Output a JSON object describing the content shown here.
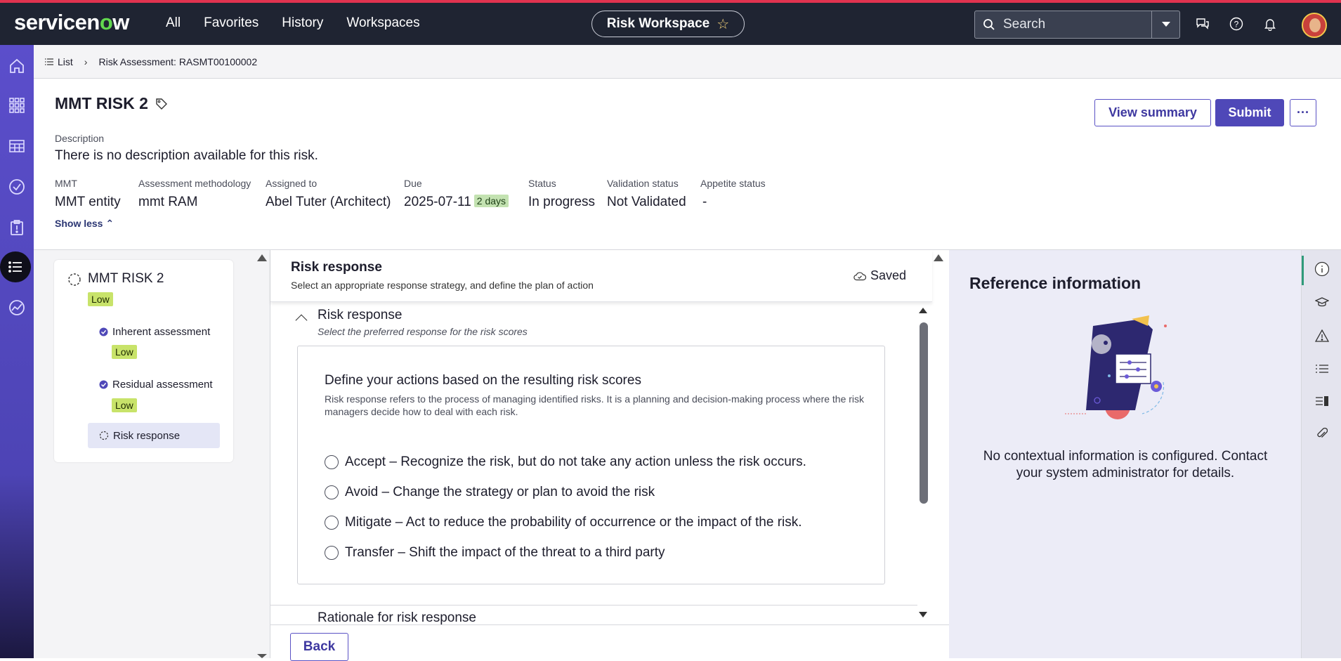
{
  "brand": {
    "logo_pre": "servicen",
    "logo_o": "o",
    "logo_post": "w",
    "accent": "#4f48b8",
    "topbar_bg": "#1f2432",
    "rail_color": "#5b4ecb",
    "low_color": "#c8e36a"
  },
  "topnav": {
    "items": [
      "All",
      "Favorites",
      "History",
      "Workspaces"
    ],
    "workspace": "Risk Workspace",
    "search_placeholder": "Search"
  },
  "breadcrumb": {
    "list": "List",
    "current": "Risk Assessment: RASMT00100002"
  },
  "header": {
    "title": "MMT RISK 2",
    "description_label": "Description",
    "description": "There is no description available for this risk.",
    "fields": [
      {
        "label": "MMT",
        "value": "MMT entity"
      },
      {
        "label": "Assessment methodology",
        "value": "mmt RAM"
      },
      {
        "label": "Assigned to",
        "value": "Abel Tuter (Architect)"
      },
      {
        "label": "Due",
        "value": "2025-07-11",
        "badge": "2 days"
      },
      {
        "label": "Status",
        "value": "In progress"
      },
      {
        "label": "Validation status",
        "value": "Not Validated"
      },
      {
        "label": "Appetite status",
        "value": "-"
      }
    ],
    "show_less": "Show less",
    "view_summary": "View summary",
    "submit": "Submit",
    "more": "···"
  },
  "steps": {
    "title": "MMT RISK 2",
    "level": "Low",
    "items": [
      {
        "label": "Inherent assessment",
        "level": "Low"
      },
      {
        "label": "Residual assessment",
        "level": "Low"
      },
      {
        "label": "Risk response"
      }
    ]
  },
  "main": {
    "title": "Risk response",
    "subtitle": "Select an appropriate response strategy, and define the plan of action",
    "saved": "Saved",
    "section_title": "Risk response",
    "section_subtitle": "Select the preferred response for the risk scores",
    "card_title": "Define your actions based on the resulting risk scores",
    "card_desc": "Risk response refers to the process of managing identified risks. It is a planning and decision-making process where the risk managers decide how to deal with each risk.",
    "options": [
      "Accept – Recognize the risk, but do not take any action unless the risk occurs.",
      "Avoid – Change the strategy or plan to avoid the risk",
      "Mitigate – Act to reduce the probability of occurrence or the impact of the risk.",
      "Transfer – Shift the impact of the threat to a third party"
    ],
    "rationale": "Rationale for risk response",
    "back": "Back"
  },
  "reference": {
    "title": "Reference information",
    "message": "No contextual information is configured. Contact your system administrator for details."
  },
  "icons": {
    "left_rail": [
      "home-icon",
      "apps-grid-icon",
      "table-icon",
      "check-circle-icon",
      "clipboard-alert-icon",
      "list-icon",
      "analytics-icon"
    ],
    "right_rail": [
      "info-icon",
      "graduation-cap-icon",
      "warning-icon",
      "list-icon",
      "panel-icon",
      "paperclip-icon"
    ],
    "top": [
      "chat-icon",
      "help-icon",
      "bell-icon"
    ]
  }
}
